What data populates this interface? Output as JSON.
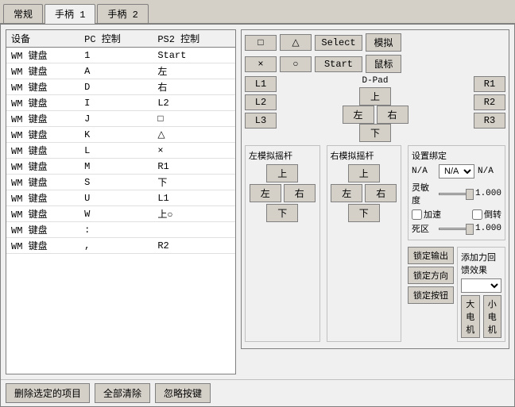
{
  "tabs": [
    {
      "id": "general",
      "label": "常规",
      "active": false
    },
    {
      "id": "pad1",
      "label": "手柄 1",
      "active": true
    },
    {
      "id": "pad2",
      "label": "手柄 2",
      "active": false
    }
  ],
  "deviceTable": {
    "headers": [
      "设备",
      "PC 控制",
      "PS2 控制"
    ],
    "rows": [
      {
        "device": "WM 键盘",
        "pc": "1",
        "ps2": "Start"
      },
      {
        "device": "WM 键盘",
        "pc": "A",
        "ps2": "左"
      },
      {
        "device": "WM 键盘",
        "pc": "D",
        "ps2": "右"
      },
      {
        "device": "WM 键盘",
        "pc": "I",
        "ps2": "L2"
      },
      {
        "device": "WM 键盘",
        "pc": "J",
        "ps2": "□"
      },
      {
        "device": "WM 键盘",
        "pc": "K",
        "ps2": "△"
      },
      {
        "device": "WM 键盘",
        "pc": "L",
        "ps2": "×"
      },
      {
        "device": "WM 键盘",
        "pc": "M",
        "ps2": "R1"
      },
      {
        "device": "WM 键盘",
        "pc": "S",
        "ps2": "下"
      },
      {
        "device": "WM 键盘",
        "pc": "U",
        "ps2": "L1"
      },
      {
        "device": "WM 键盘",
        "pc": "W",
        "ps2": "上○"
      },
      {
        "device": "WM 键盘",
        "pc": ":",
        "ps2": ""
      },
      {
        "device": "WM 键盘",
        "pc": ",",
        "ps2": "R2"
      }
    ]
  },
  "ps2": {
    "buttons": {
      "square": "□",
      "triangle": "△",
      "select": "Select",
      "simulate": "模拟",
      "cross": "×",
      "circle": "○",
      "start": "Start",
      "mouse": "鼠标",
      "L1": "L1",
      "L2": "L2",
      "L3": "L3",
      "R1": "R1",
      "R2": "R2",
      "R3": "R3",
      "dpad_up": "上",
      "dpad_left": "左",
      "dpad_right": "右",
      "dpad_down": "下",
      "dpad_label": "D-Pad"
    },
    "leftStick": {
      "label": "左模拟摇杆",
      "up": "上",
      "left": "左",
      "right": "右",
      "down": "下"
    },
    "rightStick": {
      "label": "右模拟摇杆",
      "up": "上",
      "left": "左",
      "right": "右",
      "down": "下"
    },
    "settings": {
      "label": "设置绑定",
      "na1": "N/A",
      "na2": "N/A",
      "na3": "N/A",
      "sensitivity_label": "灵敏度",
      "sensitivity_value": "1.000",
      "accelerate_label": "加速",
      "reverse_label": "倒转",
      "deadzone_label": "死区",
      "deadzone_value": "1.000"
    },
    "forceFeedback": {
      "label": "添加力回馈效果",
      "option": "",
      "large_motor": "大电机",
      "small_motor": "小电机"
    },
    "lockButtons": {
      "lock_output": "锁定输出",
      "lock_direction": "锁定方向",
      "lock_buttons": "锁定按钮"
    }
  },
  "bottomBar": {
    "delete": "删除选定的项目",
    "clear_all": "全部清除",
    "ignore": "忽略按键"
  }
}
